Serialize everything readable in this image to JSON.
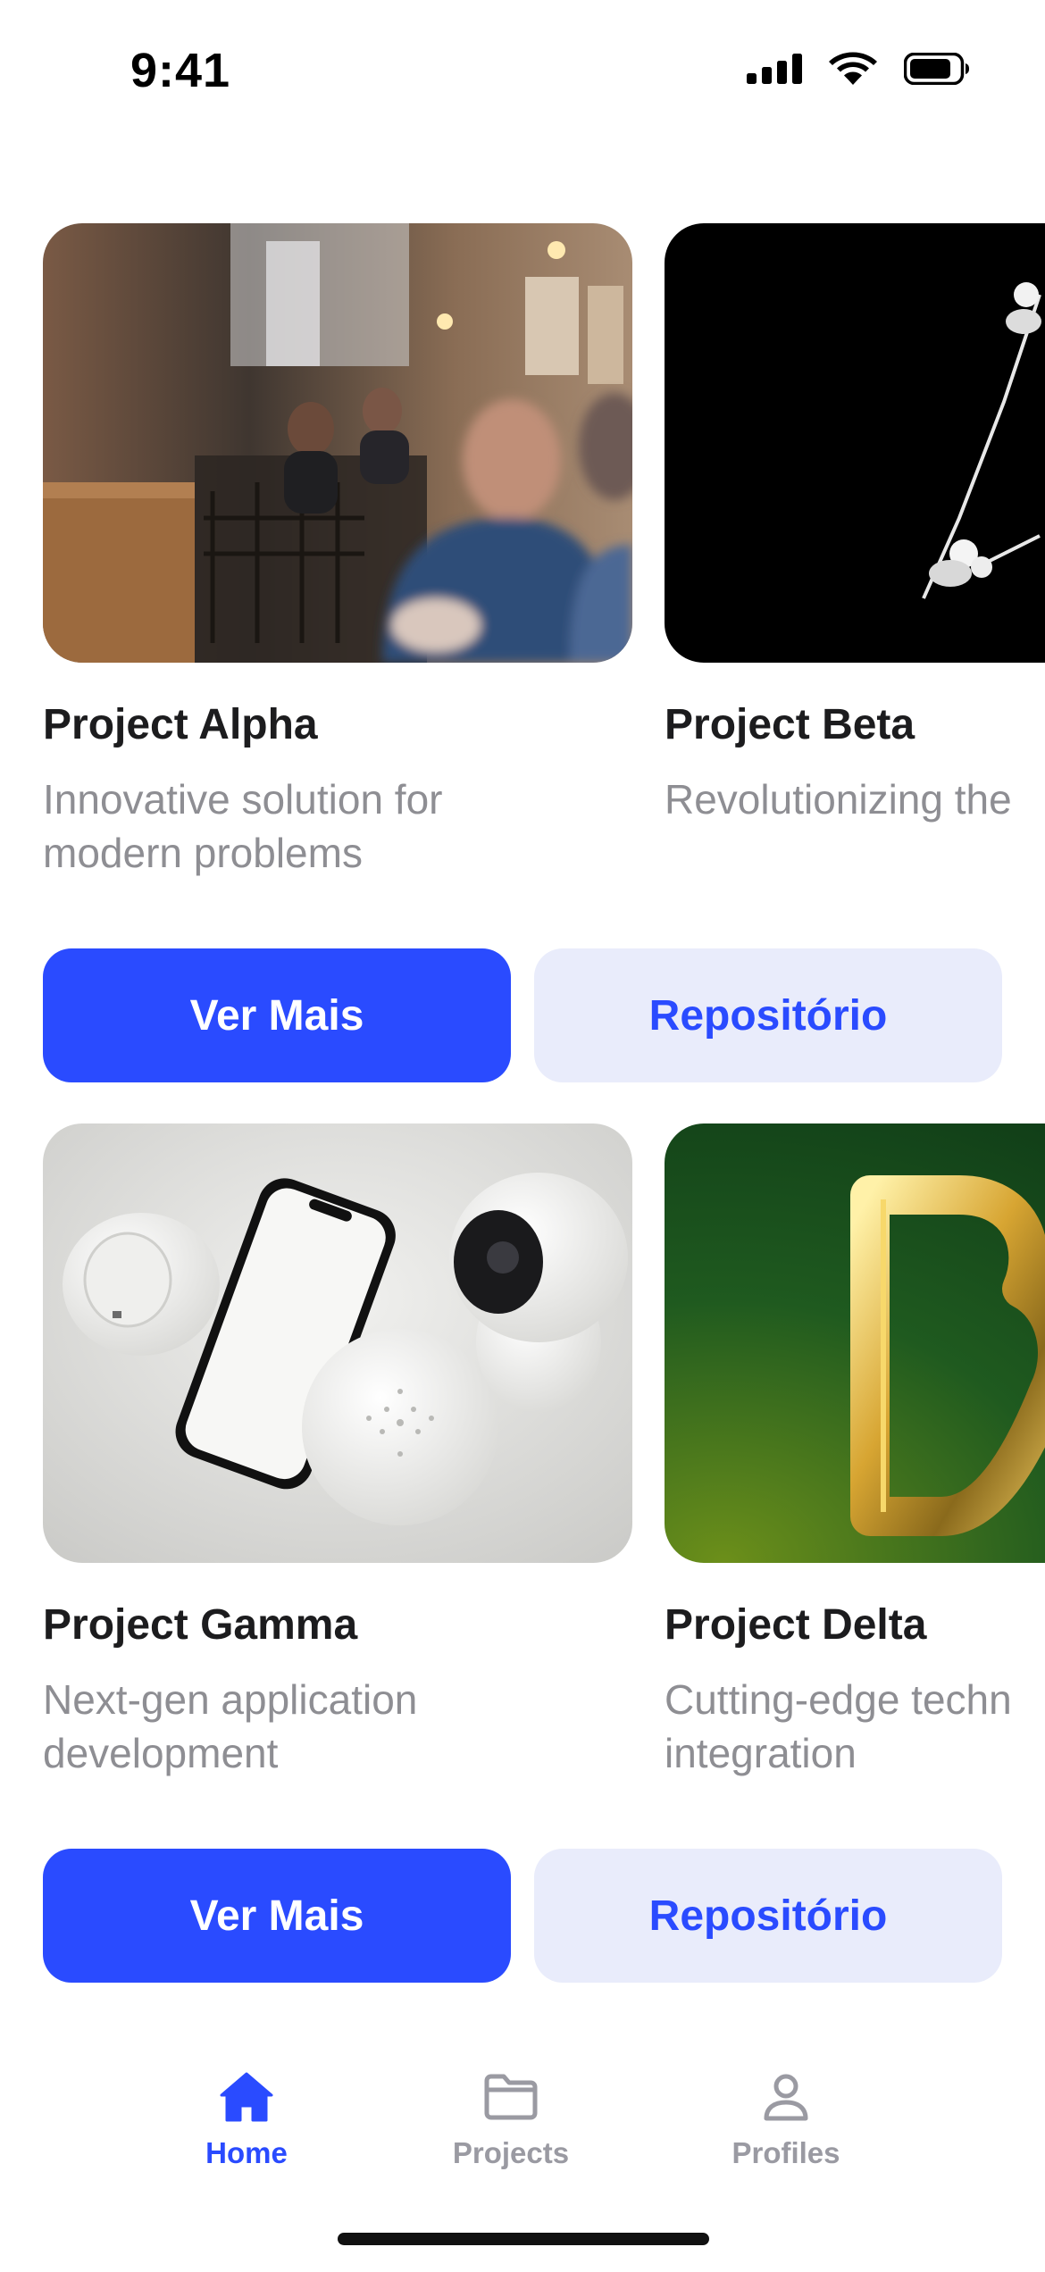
{
  "status_bar": {
    "time": "9:41"
  },
  "rows": [
    {
      "cards": [
        {
          "title": "Project Alpha",
          "description_lines": [
            "Innovative solution for",
            "modern problems"
          ],
          "image": "cafe-photo"
        },
        {
          "title": "Project Beta",
          "description_lines": [
            "Revolutionizing the",
            ""
          ],
          "image": "dark-abstract-photo"
        }
      ],
      "buttons": {
        "primary": "Ver Mais",
        "secondary": "Repositório"
      }
    },
    {
      "cards": [
        {
          "title": "Project Gamma",
          "description_lines": [
            "Next-gen application",
            "development"
          ],
          "image": "smart-devices-photo"
        },
        {
          "title": "Project Delta",
          "description_lines": [
            "Cutting-edge techn",
            "integration"
          ],
          "image": "golden-letter-photo"
        }
      ],
      "buttons": {
        "primary": "Ver Mais",
        "secondary": "Repositório"
      }
    }
  ],
  "tab_bar": {
    "items": [
      {
        "label": "Home",
        "icon": "home-icon",
        "active": true
      },
      {
        "label": "Projects",
        "icon": "folder-icon",
        "active": false
      },
      {
        "label": "Profiles",
        "icon": "person-icon",
        "active": false
      }
    ]
  },
  "colors": {
    "accent": "#2A4BFF",
    "secondary_button_bg": "#E9ECFB",
    "muted_text": "#8E8E93",
    "title_text": "#1C1C1E"
  }
}
